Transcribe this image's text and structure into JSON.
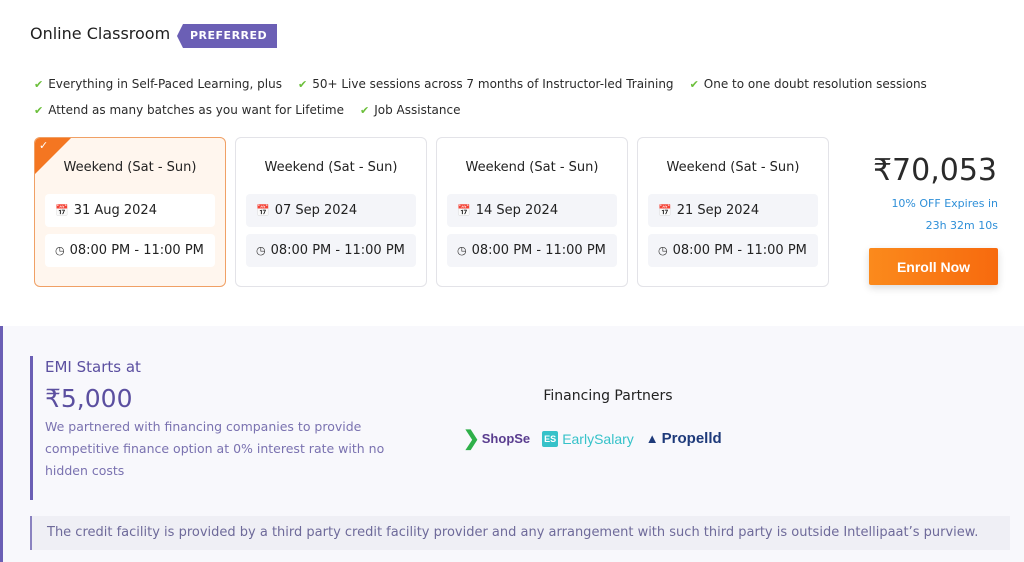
{
  "header": {
    "title": "Online Classroom",
    "badge": "PREFERRED"
  },
  "features": [
    [
      "Everything in Self-Paced Learning, plus",
      "50+ Live sessions across 7 months of Instructor-led Training",
      "One to one doubt resolution sessions"
    ],
    [
      "Attend as many batches as you want for Lifetime",
      "Job Assistance"
    ]
  ],
  "batches": [
    {
      "title": "Weekend (Sat - Sun)",
      "date": "31 Aug 2024",
      "time": "08:00 PM - 11:00 PM",
      "selected": true
    },
    {
      "title": "Weekend (Sat - Sun)",
      "date": "07 Sep 2024",
      "time": "08:00 PM - 11:00 PM",
      "selected": false
    },
    {
      "title": "Weekend (Sat - Sun)",
      "date": "14 Sep 2024",
      "time": "08:00 PM - 11:00 PM",
      "selected": false
    },
    {
      "title": "Weekend (Sat - Sun)",
      "date": "21 Sep 2024",
      "time": "08:00 PM - 11:00 PM",
      "selected": false
    }
  ],
  "icons": {
    "check": "✔",
    "calendar": "📅",
    "clock": "◷",
    "selected_check": "✓"
  },
  "pricing": {
    "price": "₹70,053",
    "offer_line1": "10% OFF Expires in",
    "offer_line2": "23h 32m 10s",
    "enroll_label": "Enroll Now"
  },
  "emi": {
    "title": "EMI Starts at",
    "amount": "₹5,000",
    "description": "We partnered with financing companies to provide competitive finance option at 0% interest rate with no hidden costs"
  },
  "financing": {
    "title": "Financing Partners",
    "partners": [
      {
        "name": "ShopSe",
        "logo": "❯"
      },
      {
        "name": "EarlySalary",
        "logo": "ES"
      },
      {
        "name": "Propelld",
        "logo": "▲"
      }
    ]
  },
  "disclaimer": "The credit facility is provided by a third party credit facility provider and any arrangement with such third party is outside Intellipaat’s purview.",
  "colors": {
    "brand_purple": "#6b5fb5",
    "accent_orange": "#f47621",
    "offer_blue": "#2e8fd8",
    "check_green": "#6bbf3a"
  }
}
